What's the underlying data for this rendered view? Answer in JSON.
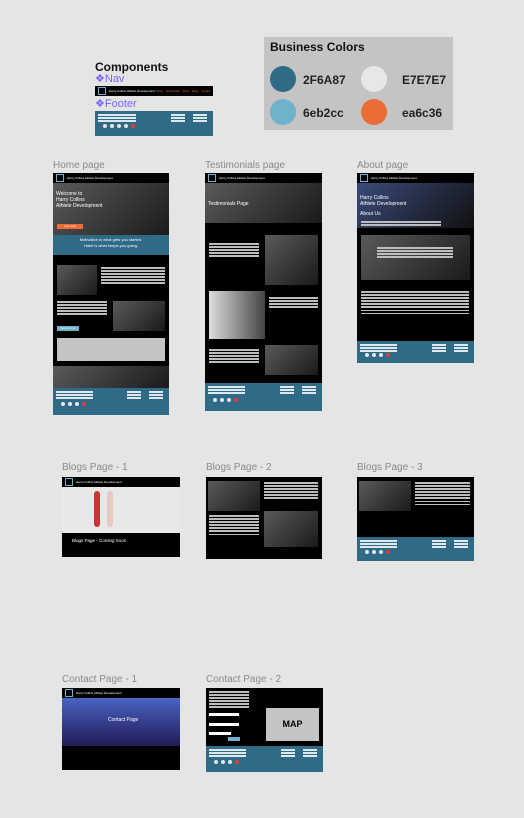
{
  "components": {
    "title": "Components",
    "nav_label": "Nav",
    "footer_label": "Footer",
    "nav_brand": "Harry Collins Athlete Development"
  },
  "business_colors": {
    "title": "Business Colors",
    "colors": [
      {
        "hex": "2F6A87",
        "color": "#2f6a87"
      },
      {
        "hex": "E7E7E7",
        "color": "#e7e7e7"
      },
      {
        "hex": "6eb2cc",
        "color": "#6eb2cc"
      },
      {
        "hex": "ea6c36",
        "color": "#ea6c36"
      }
    ]
  },
  "frames": {
    "home": {
      "title": "Home page",
      "hero_heading": "Welcome to\nHarry Collins\nAthlete Development",
      "hero_button": "Get now",
      "quote": "Motivation is what gets you started.\nHabit is what keeps you going.",
      "button": "Read more"
    },
    "testimonials": {
      "title": "Testimonials page",
      "hero_heading": "Testimonials Page"
    },
    "about": {
      "title": "About page",
      "hero_heading": "Harry Collins\nAthlete Development",
      "sub_heading": "About Us"
    },
    "blogs1": {
      "title": "Blogs Page - 1",
      "heading": "Blogs Page - Coming Soon"
    },
    "blogs2": {
      "title": "Blogs Page - 2"
    },
    "blogs3": {
      "title": "Blogs Page - 3"
    },
    "contact1": {
      "title": "Contact Page - 1",
      "heading": "Contact Page"
    },
    "contact2": {
      "title": "Contact Page - 2",
      "map_label": "MAP"
    }
  },
  "nav_links": [
    "Home",
    "Testimonials",
    "About",
    "Blogs",
    "Contact"
  ]
}
